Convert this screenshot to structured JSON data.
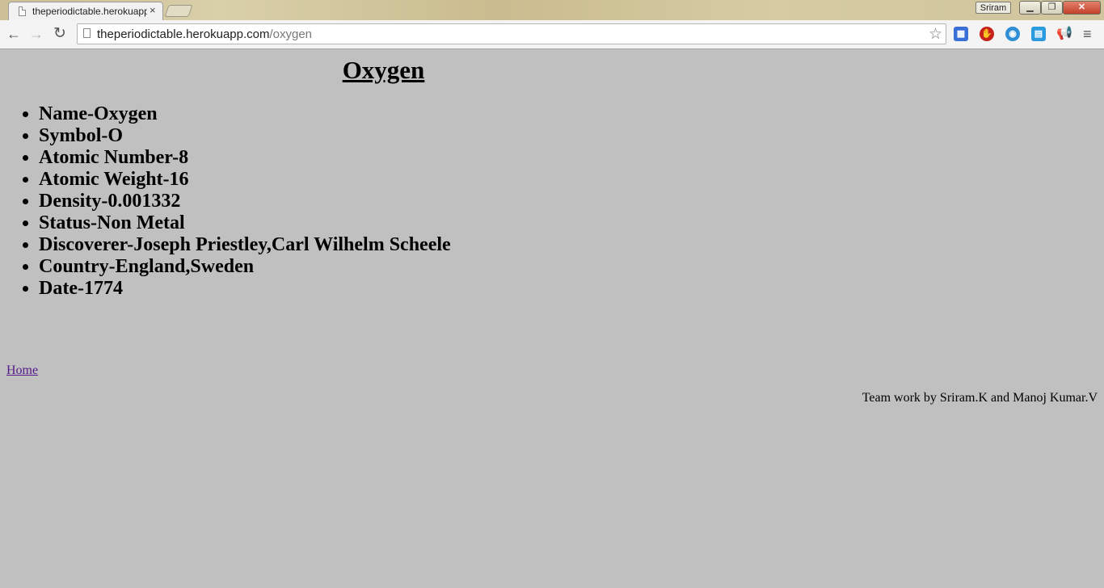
{
  "browser": {
    "tab_title": "theperiodictable.herokuapp.com/oxygen",
    "tab_close": "×",
    "user_name": "Sriram",
    "window_min": "▁",
    "window_max": "❐",
    "window_close": "✕",
    "url_host": "theperiodictable.herokuapp.com",
    "url_path": "/oxygen",
    "back_icon": "←",
    "forward_icon": "→",
    "reload_icon": "↻",
    "star_icon": "☆",
    "menu_icon": "≡"
  },
  "page": {
    "title": "Oxygen",
    "facts": [
      "Name-Oxygen",
      "Symbol-O",
      "Atomic Number-8",
      "Atomic Weight-16",
      "Density-0.001332",
      "Status-Non Metal",
      "Discoverer-Joseph Priestley,Carl Wilhelm Scheele",
      "Country-England,Sweden",
      "Date-1774"
    ],
    "home_link": "Home",
    "credits": "Team work by Sriram.K and Manoj Kumar.V"
  },
  "colors": {
    "page_background": "#c0c0c0",
    "visited_link": "#551a8b"
  }
}
